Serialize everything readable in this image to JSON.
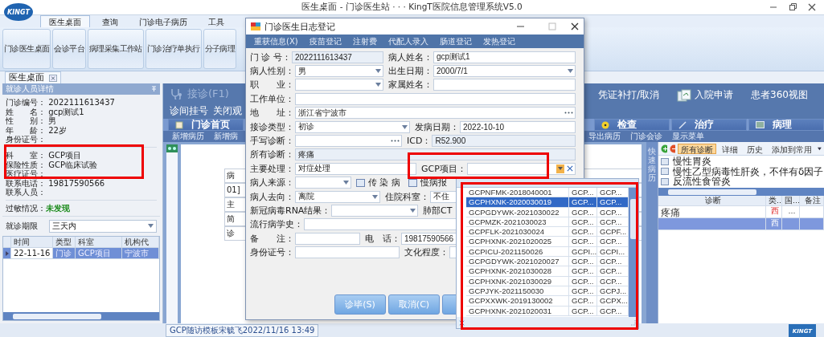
{
  "app": {
    "title": "医生桌面 - 门诊医生站 · · · KingT医院信息管理系统V5.0",
    "logo": "KINGT",
    "corner_logo": "KINGT"
  },
  "ribbon_tabs": [
    {
      "label": "医生桌面",
      "selected": true
    },
    {
      "label": "查询",
      "selected": false
    },
    {
      "label": "门诊电子病历",
      "selected": false
    },
    {
      "label": "工具",
      "selected": false
    }
  ],
  "ribbon_buttons": [
    "门诊医生桌面",
    "会诊平台",
    "病理采集工作站",
    "门诊治疗单执行",
    "分子病理"
  ],
  "doc_tab": {
    "label": "医生桌面"
  },
  "patient_panel": {
    "title": "就诊人员详情",
    "fields": [
      {
        "label": "门诊编号：",
        "value": "2022111613437"
      },
      {
        "label": "姓　　名：",
        "value": "gcp测试1"
      },
      {
        "label": "性　　别：",
        "value": "男"
      },
      {
        "label": "年　　龄：",
        "value": "22岁"
      },
      {
        "label": "身份证号："
      },
      {
        "label": "科　　室：",
        "value": "GCP项目"
      },
      {
        "label": "保险性质：",
        "value": "GCP临床试验"
      },
      {
        "label": "医疗证号："
      },
      {
        "label": "联系电话：",
        "value": "19817590566"
      },
      {
        "label": "联系人员："
      }
    ],
    "allergy": {
      "label": "过敏情况：",
      "value": "未发现"
    },
    "visit_period": {
      "label": "就诊期限",
      "value": "三天内"
    },
    "visits_table": {
      "columns": [
        "时间",
        "类型",
        "科室",
        "机构代"
      ],
      "rows": [
        {
          "cells": [
            "22-11-16",
            "门诊",
            "GCP项目",
            "宁波市"
          ],
          "selected": true
        }
      ]
    }
  },
  "workbench": {
    "reception": "接诊(F1)",
    "actions_left": [
      "诊间挂号",
      "关闭观"
    ],
    "actions_right": [
      {
        "label": "凭证补打/取消",
        "kind": "text"
      },
      {
        "label": "入院申请",
        "kind": "icon"
      },
      {
        "label": "患者360视图",
        "kind": "text"
      }
    ],
    "record_tabs": [
      {
        "label": "门诊首页",
        "kind": "home"
      },
      {
        "label": "检查",
        "kind": "exam"
      },
      {
        "label": "治疗",
        "kind": "treat"
      },
      {
        "label": "病理",
        "kind": "patho"
      }
    ],
    "toolbar_left": [
      "新增病历",
      "新增病"
    ],
    "toolbar_right": [
      "导出病历",
      "门诊会诊",
      "显示菜单"
    ],
    "document_fragments": [
      "病",
      "01]",
      "主",
      "简",
      "诊"
    ],
    "status_tab": "GCP随访模板宋毓飞2022/11/16 13:49"
  },
  "quick_panel": {
    "side_tab": "快速病历",
    "toolbar": [
      {
        "label": "所有诊断",
        "selected": true
      },
      {
        "label": "详细",
        "selected": false
      },
      {
        "label": "历史",
        "selected": false
      },
      {
        "label": "添加到常用",
        "selected": false
      }
    ],
    "common_diagnoses": [
      "慢性胃炎",
      "慢性乙型病毒性肝炎，不伴有δ因子",
      "反流性食管炎"
    ],
    "table": {
      "columns": [
        "诊断",
        "类..",
        "国...",
        "备注"
      ],
      "rows": [
        {
          "diagnosis": "疼痛",
          "type": "西",
          "code": "...",
          "selected": false
        },
        {
          "type": "西",
          "selected": true
        }
      ]
    }
  },
  "dialog": {
    "title": "门诊医生日志登记",
    "menu": [
      "重获信息(X)",
      "疫苗登记",
      "注射费",
      "代配人录入",
      "肠道登记",
      "发热登记"
    ],
    "rows": [
      [
        {
          "label": "门 诊 号：",
          "value": "2022111613437",
          "kind": "readonly"
        },
        {
          "label": "病人姓名：",
          "value": "gcp测试1",
          "kind": "text"
        }
      ],
      [
        {
          "label": "病人性别：",
          "value": "男",
          "kind": "select"
        },
        {
          "label": "出生日期：",
          "value": "2000/7/1",
          "kind": "select"
        }
      ],
      [
        {
          "label": "职　　业：",
          "kind": "select"
        },
        {
          "label": "家属姓名：",
          "kind": "text"
        }
      ],
      [
        {
          "label": "工作单位：",
          "kind": "text"
        }
      ],
      [
        {
          "label": "地　　址：",
          "value": "浙江省宁波市",
          "kind": "picker"
        }
      ],
      [
        {
          "label": "接诊类型：",
          "value": "初诊",
          "kind": "select"
        },
        {
          "label": "发病日期：",
          "value": "2022-10-10",
          "kind": "text"
        }
      ],
      [
        {
          "label": "手写诊断：",
          "kind": "picker"
        },
        {
          "label": "ICD：",
          "value": "R52.900",
          "kind": "readonly"
        }
      ],
      [
        {
          "label": "所有诊断：",
          "value": "疼痛",
          "kind": "readonly"
        }
      ],
      [
        {
          "label": "主要处理：",
          "value": "对症处理",
          "kind": "text"
        },
        {
          "label": "GCP项目：",
          "kind": "clearable"
        }
      ],
      [
        {
          "label": "病人来源：",
          "kind": "select"
        },
        {
          "label": "传 染 病",
          "kind": "check",
          "checked": false
        },
        {
          "label": "慢病报",
          "kind": "check",
          "checked": false
        }
      ],
      [
        {
          "label": "病人去向：",
          "value": "离院",
          "kind": "select"
        },
        {
          "label": "住院科室：",
          "value": "不住",
          "kind": "select"
        }
      ],
      [
        {
          "label": "新冠病毒RNA结果：",
          "kind": "select"
        },
        {
          "label": "肺部CT",
          "kind": "label"
        }
      ],
      [
        {
          "label": "流行病学史：",
          "kind": "text"
        }
      ],
      [
        {
          "label": "备　　注：",
          "kind": "text"
        },
        {
          "label": "电　话：",
          "value": "19817590566",
          "kind": "text"
        }
      ],
      [
        {
          "label": "身份证号：",
          "kind": "text"
        },
        {
          "label": "文化程度：",
          "kind": "text"
        }
      ]
    ],
    "buttons": [
      "诊毕(S)",
      "取消(C)"
    ]
  },
  "gcp_dropdown": {
    "rows": [
      {
        "cells": [
          "GCPNFMK-2018040001",
          "GCP...",
          "GCP..."
        ],
        "selected": false
      },
      {
        "cells": [
          "GCPHXNK-2020030019",
          "GCP...",
          "GCP..."
        ],
        "selected": true
      },
      {
        "cells": [
          "GCPGDYWK-2021030022",
          "GCP...",
          "GCP..."
        ],
        "selected": false
      },
      {
        "cells": [
          "GCPMZK-2021030023",
          "GCP...",
          "GCP..."
        ],
        "selected": false
      },
      {
        "cells": [
          "GCPFLK-2021030024",
          "GCP...",
          "GCPF..."
        ],
        "selected": false
      },
      {
        "cells": [
          "GCPHXNK-2021020025",
          "GCP...",
          "GCP..."
        ],
        "selected": false
      },
      {
        "cells": [
          "GCPICU-2021150026",
          "GCPI...",
          "GCPI..."
        ],
        "selected": false
      },
      {
        "cells": [
          "GCPGDYWK-2021020027",
          "GCP...",
          "GCP..."
        ],
        "selected": false
      },
      {
        "cells": [
          "GCPHXNK-2021030028",
          "GCP...",
          "GCP..."
        ],
        "selected": false
      },
      {
        "cells": [
          "GCPHXNK-2021030029",
          "GCP...",
          "GCP..."
        ],
        "selected": false
      },
      {
        "cells": [
          "GCPJYK-2021150030",
          "GCP...",
          "GCPJ..."
        ],
        "selected": false
      },
      {
        "cells": [
          "GCPXXWK-2019130002",
          "GCP...",
          "GCPX..."
        ],
        "selected": false
      },
      {
        "cells": [
          "GCPHXNK-2021020031",
          "GCP...",
          "GCP..."
        ],
        "selected": false
      }
    ]
  }
}
